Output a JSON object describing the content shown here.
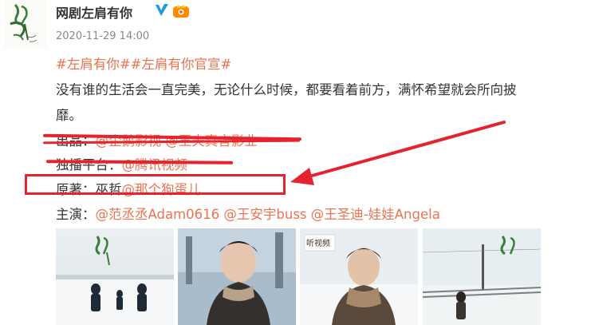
{
  "post": {
    "username": "网剧左肩有你",
    "timestamp": "2020-11-29 14:00",
    "topic_1": "#左肩有你#",
    "topic_2": "#左肩有你官宣#",
    "body_line_1": "没有谁的生活会一直完美，无论什么时候，都要看着前方，满怀希望就会所向披",
    "body_line_2": "靡。"
  },
  "credits": {
    "producer_label": "出品：",
    "producer_1": "@企鹅影视",
    "producer_2": "@王夫真言影业",
    "platform_label": "独播平台：",
    "platform": "@腾讯视频",
    "original_label": "原著：",
    "original_author_plain": "巫哲",
    "original_author_link": "@那个狗蛋儿",
    "cast_label": "主演：",
    "cast_1": "@范丞丞Adam0616",
    "cast_2": "@王安宇buss",
    "cast_3": "@王圣迪-娃娃Angela"
  },
  "photos": [
    {
      "icon": "snowfield-walkers-poster-image"
    },
    {
      "icon": "young-man-portrait-image"
    },
    {
      "icon": "young-man-scarf-portrait-image"
    },
    {
      "icon": "snow-railway-poster-image"
    }
  ],
  "colors": {
    "link": "#eb7350",
    "annotation_red": "#e4232e",
    "verified_blue": "#1f9ae0"
  }
}
